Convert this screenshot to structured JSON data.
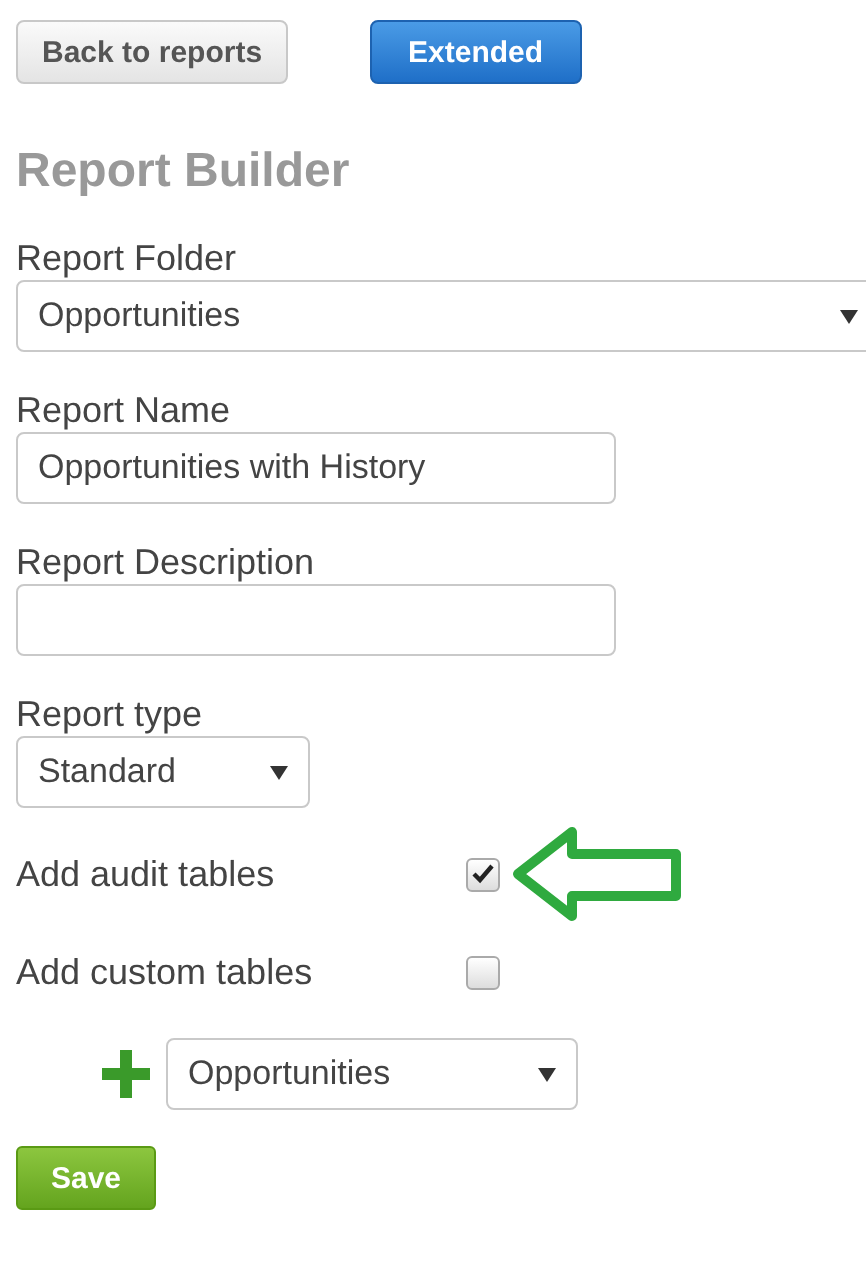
{
  "toolbar": [
    {
      "label": "Back to reports",
      "kind": "default"
    },
    {
      "label": "Extended",
      "kind": "primary"
    }
  ],
  "title": "Report Builder",
  "fields": [
    {
      "label": "Report Folder",
      "kind": "select",
      "value": "Opportunities"
    },
    {
      "label": "Report Name",
      "kind": "text",
      "value": "Opportunities with History"
    },
    {
      "label": "Report Description",
      "kind": "text"
    },
    {
      "label": "Report type",
      "kind": "select",
      "value": "Standard"
    }
  ],
  "options": [
    {
      "label": "Add audit tables",
      "checked": true,
      "highlighted": true
    },
    {
      "label": "Add custom tables",
      "checked": false,
      "highlighted": false
    }
  ],
  "table_picker": {
    "value": "Opportunities"
  },
  "save_button": {
    "label": "Save"
  }
}
